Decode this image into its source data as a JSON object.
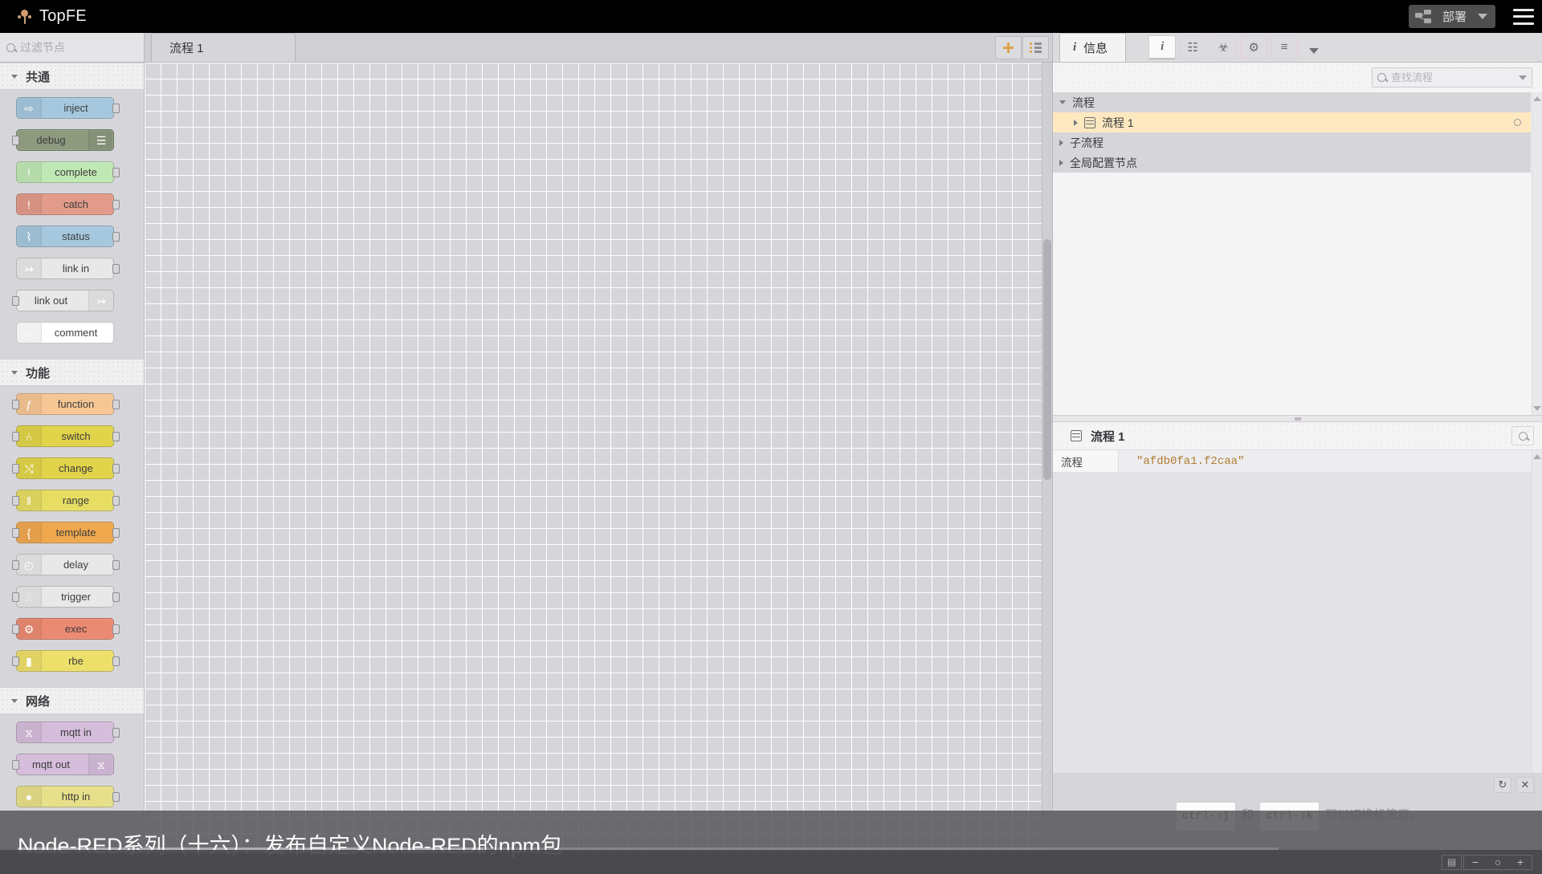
{
  "header": {
    "brand": "TopFE",
    "brand_icon": "node-red-logo-icon",
    "deploy_label": "部署",
    "deploy_icon": "deploy-nodes-icon",
    "menu_icon": "hamburger-menu-icon"
  },
  "palette": {
    "search_placeholder": "过滤节点",
    "search_value": "",
    "search_icon": "search-icon",
    "categories": [
      {
        "name": "共通",
        "nodes": [
          {
            "label": "inject",
            "color": "#a6c8de",
            "icon": "arrow-right-icon",
            "glyph": "⇨",
            "icon_side": "left",
            "has_input": false,
            "has_output": true
          },
          {
            "label": "debug",
            "color": "#8d9a7e",
            "icon": "debug-bars-icon",
            "glyph": "☰",
            "icon_side": "right",
            "has_input": true,
            "has_output": false
          },
          {
            "label": "complete",
            "color": "#c0e8b4",
            "icon": "exclamation-icon",
            "glyph": "!",
            "icon_side": "left",
            "has_input": false,
            "has_output": true
          },
          {
            "label": "catch",
            "color": "#e29b8a",
            "icon": "exclamation-icon",
            "glyph": "!",
            "icon_side": "left",
            "has_input": false,
            "has_output": true
          },
          {
            "label": "status",
            "color": "#a6c8de",
            "icon": "pulse-wave-icon",
            "glyph": "⌇",
            "icon_side": "left",
            "has_input": false,
            "has_output": true
          },
          {
            "label": "link in",
            "color": "#e8e8e8",
            "icon": "link-in-icon",
            "glyph": "↣",
            "icon_side": "left",
            "has_input": false,
            "has_output": true
          },
          {
            "label": "link out",
            "color": "#e8e8e8",
            "icon": "link-out-icon",
            "glyph": "↣",
            "icon_side": "right",
            "has_input": true,
            "has_output": false
          },
          {
            "label": "comment",
            "color": "#ffffff",
            "icon": "comment-icon",
            "glyph": "○",
            "icon_side": "left",
            "has_input": false,
            "has_output": false
          }
        ]
      },
      {
        "name": "功能",
        "nodes": [
          {
            "label": "function",
            "color": "#f7c695",
            "icon": "function-f-icon",
            "glyph": "ƒ",
            "icon_side": "left",
            "has_input": true,
            "has_output": true
          },
          {
            "label": "switch",
            "color": "#e2d44a",
            "icon": "switch-icon",
            "glyph": "⑃",
            "icon_side": "left",
            "has_input": true,
            "has_output": true
          },
          {
            "label": "change",
            "color": "#e2d44a",
            "icon": "change-swap-icon",
            "glyph": "⤭",
            "icon_side": "left",
            "has_input": true,
            "has_output": true
          },
          {
            "label": "range",
            "color": "#e7dd63",
            "icon": "range-bars-icon",
            "glyph": "‖",
            "icon_side": "left",
            "has_input": true,
            "has_output": true
          },
          {
            "label": "template",
            "color": "#f0a84f",
            "icon": "brace-icon",
            "glyph": "{",
            "icon_side": "left",
            "has_input": true,
            "has_output": true
          },
          {
            "label": "delay",
            "color": "#e8e8e8",
            "icon": "clock-icon",
            "glyph": "◴",
            "icon_side": "left",
            "has_input": true,
            "has_output": true
          },
          {
            "label": "trigger",
            "color": "#e8e8e8",
            "icon": "pulse-step-icon",
            "glyph": "⎍",
            "icon_side": "left",
            "has_input": true,
            "has_output": true
          },
          {
            "label": "exec",
            "color": "#eb8a72",
            "icon": "gear-icon",
            "glyph": "⚙",
            "icon_side": "left",
            "has_input": true,
            "has_output": true
          },
          {
            "label": "rbe",
            "color": "#ede06a",
            "icon": "filter-icon",
            "glyph": "▮",
            "icon_side": "left",
            "has_input": true,
            "has_output": true
          }
        ]
      },
      {
        "name": "网络",
        "nodes": [
          {
            "label": "mqtt in",
            "color": "#d5bddb",
            "icon": "wifi-icon",
            "glyph": "⧖",
            "icon_side": "left",
            "has_input": false,
            "has_output": true
          },
          {
            "label": "mqtt out",
            "color": "#d5bddb",
            "icon": "wifi-icon",
            "glyph": "⧖",
            "icon_side": "right",
            "has_input": true,
            "has_output": false
          },
          {
            "label": "http in",
            "color": "#e7e08a",
            "icon": "globe-icon",
            "glyph": "●",
            "icon_side": "left",
            "has_input": false,
            "has_output": true
          }
        ]
      }
    ],
    "collapse_icon": "collapse-all-icon",
    "expand_icon": "expand-all-icon"
  },
  "workspace": {
    "tabs": [
      {
        "label": "流程 1",
        "active": true
      }
    ],
    "add_tab_icon": "plus-icon",
    "list_tabs_icon": "list-icon"
  },
  "sidebar": {
    "active_tab": {
      "label": "信息",
      "icon": "info-icon"
    },
    "tab_buttons": [
      {
        "name": "info-icon",
        "glyph": "i",
        "active": true
      },
      {
        "name": "help-book-icon",
        "glyph": "☷",
        "active": false
      },
      {
        "name": "debug-bug-icon",
        "glyph": "☣",
        "active": false
      },
      {
        "name": "config-gear-icon",
        "glyph": "⚙",
        "active": false
      },
      {
        "name": "context-stack-icon",
        "glyph": "≡",
        "active": false
      }
    ],
    "more_tabs_icon": "chevron-down-icon",
    "search_placeholder": "查找流程",
    "search_value": "",
    "search_icon": "search-icon",
    "tree": [
      {
        "label": "流程",
        "type": "group",
        "expanded": true,
        "indent": 0
      },
      {
        "label": "流程 1",
        "type": "flow",
        "expanded": false,
        "indent": 1,
        "selected": true,
        "status_icon": "ring-icon"
      },
      {
        "label": "子流程",
        "type": "group",
        "expanded": false,
        "indent": 0
      },
      {
        "label": "全局配置节点",
        "type": "group",
        "expanded": false,
        "indent": 0
      }
    ],
    "detail": {
      "title": "流程 1",
      "title_icon": "flow-icon",
      "search_icon": "search-icon",
      "properties": [
        {
          "key": "流程",
          "value": "\"afdb0fa1.f2caa\""
        }
      ]
    },
    "hint": {
      "refresh_icon": "refresh-icon",
      "close_icon": "close-icon",
      "key1": "ctrl-⇧j",
      "conj": "和",
      "key2": "ctrl-⇧k",
      "tail": "可以切换标签页。"
    }
  },
  "overlay": {
    "title": "Node-RED系列（十六）：发布自定义Node-RED的npm包",
    "buttons": [
      {
        "name": "map-view-icon",
        "glyph": "▤"
      }
    ],
    "zoom": [
      {
        "name": "zoom-out-button",
        "glyph": "−"
      },
      {
        "name": "zoom-reset-button",
        "glyph": "○"
      },
      {
        "name": "zoom-in-button",
        "glyph": "+"
      }
    ]
  },
  "colors": {
    "canvas_bg": "#d6d6da",
    "grid_line": "#ffffff",
    "header_bg": "#000000",
    "selection": "#fde8c0",
    "value_text": "#b07a2e"
  }
}
